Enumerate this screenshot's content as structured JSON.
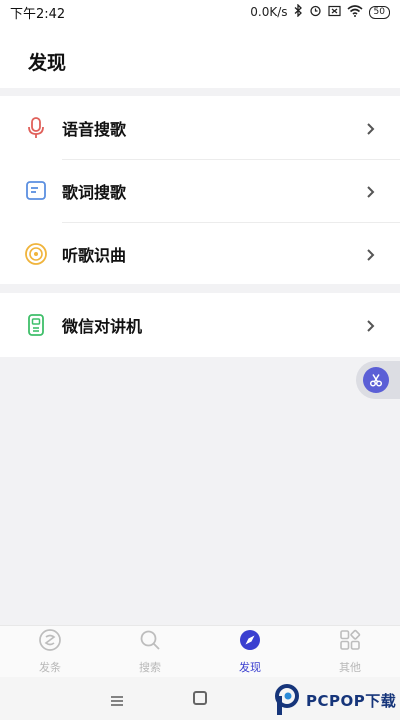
{
  "status_bar": {
    "time": "下午2:42",
    "network_speed": "0.0K/s",
    "battery": "50"
  },
  "header": {
    "title": "发现"
  },
  "discover": {
    "items": [
      {
        "label": "语音搜歌",
        "icon": "microphone-icon",
        "color": "#e0605a"
      },
      {
        "label": "歌词搜歌",
        "icon": "lyrics-icon",
        "color": "#5b8fe0"
      },
      {
        "label": "听歌识曲",
        "icon": "music-disc-icon",
        "color": "#f0b43c"
      }
    ],
    "extra_items": [
      {
        "label": "微信对讲机",
        "icon": "walkie-talkie-icon",
        "color": "#3fbf6a"
      }
    ]
  },
  "bottom_nav": {
    "items": [
      {
        "label": "发条",
        "icon": "wind-up-icon",
        "active": false
      },
      {
        "label": "搜索",
        "icon": "search-icon",
        "active": false
      },
      {
        "label": "发现",
        "icon": "compass-icon",
        "active": true
      },
      {
        "label": "其他",
        "icon": "apps-icon",
        "active": false
      }
    ],
    "active_color": "#3a3fd0",
    "inactive_color": "#b8b8b8"
  },
  "watermark": {
    "text": "PCPOP下载"
  }
}
